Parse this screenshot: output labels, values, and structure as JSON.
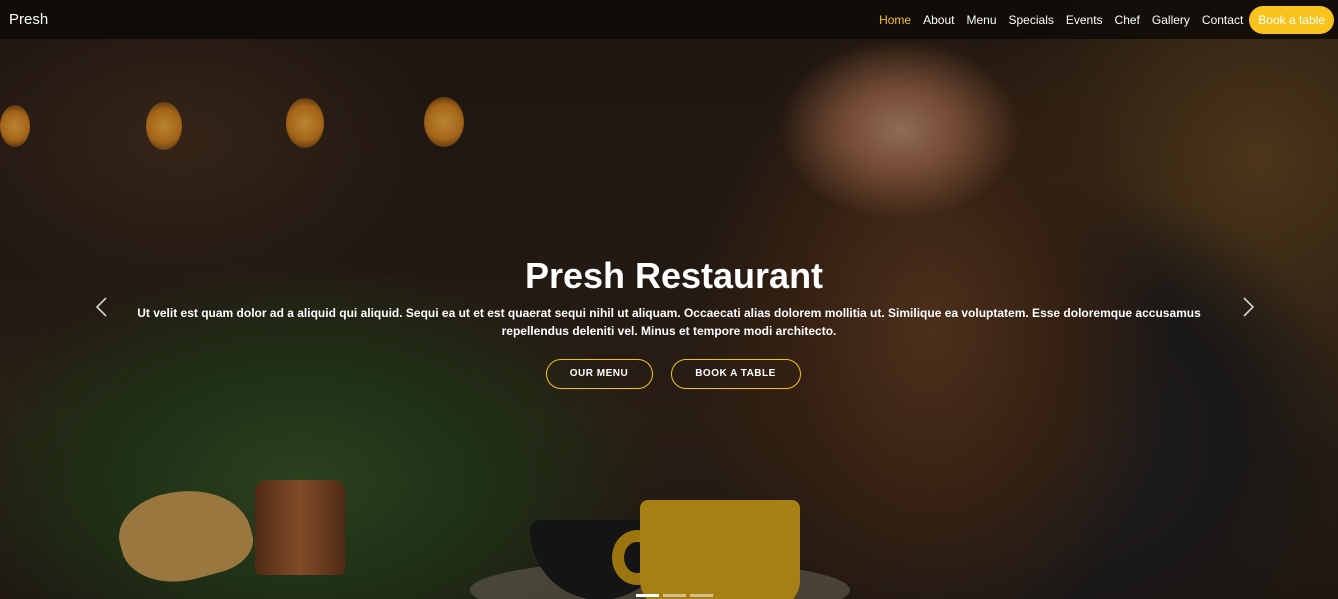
{
  "brand": {
    "name": "Presh"
  },
  "nav": {
    "items": [
      {
        "label": "Home",
        "active": true
      },
      {
        "label": "About",
        "active": false
      },
      {
        "label": "Menu",
        "active": false
      },
      {
        "label": "Specials",
        "active": false
      },
      {
        "label": "Events",
        "active": false
      },
      {
        "label": "Chef",
        "active": false
      },
      {
        "label": "Gallery",
        "active": false
      },
      {
        "label": "Contact",
        "active": false
      }
    ],
    "cta_label": "Book a table"
  },
  "hero": {
    "title": "Presh Restaurant",
    "text": "Ut velit est quam dolor ad a aliquid qui aliquid. Sequi ea ut et est quaerat sequi nihil ut aliquam. Occaecati alias dolorem mollitia ut. Similique ea voluptatem. Esse doloremque accusamus repellendus deleniti vel. Minus et tempore modi architecto.",
    "buttons": {
      "menu": "OUR MENU",
      "book": "BOOK A TABLE"
    }
  },
  "carousel": {
    "prev_icon": "chevron-left-icon",
    "next_icon": "chevron-right-icon",
    "slide_count": 3,
    "active_slide": 1
  },
  "colors": {
    "accent": "#f7c31c",
    "header_bg": "#0c0a08",
    "text": "#ffffff"
  }
}
